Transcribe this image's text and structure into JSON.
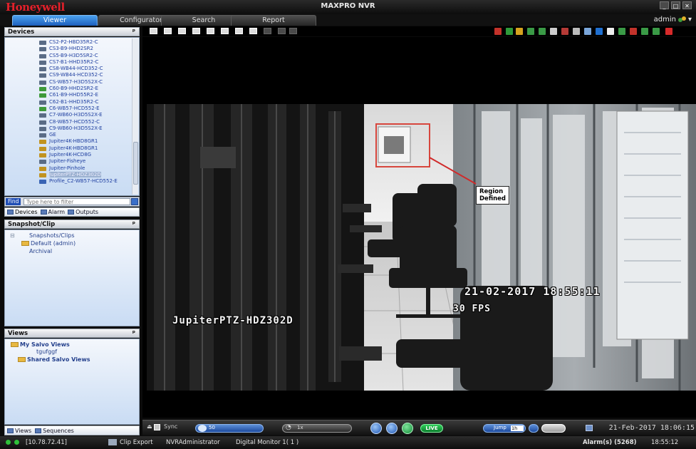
{
  "app": {
    "brand": "Honeywell",
    "title": "MAXPRO NVR",
    "user": "admin"
  },
  "tabs": [
    {
      "label": "Viewer",
      "active": true
    },
    {
      "label": "Configurator",
      "active": false
    },
    {
      "label": "Search",
      "active": false
    },
    {
      "label": "Report",
      "active": false
    }
  ],
  "devices_panel": {
    "title": "Devices",
    "items": [
      {
        "label": "CS2-P2-HBD35R2-C",
        "icon": "camera-icon"
      },
      {
        "label": "CS3-B9-HHD2SR2",
        "icon": "camera-icon"
      },
      {
        "label": "CS5-B9-H3D5SR2-C",
        "icon": "camera-icon"
      },
      {
        "label": "CS7-B1-HHD35R2-C",
        "icon": "camera-icon"
      },
      {
        "label": "CS8-WB44-HCD352-C",
        "icon": "camera-icon"
      },
      {
        "label": "CS9-WB44-HCD352-C",
        "icon": "camera-icon"
      },
      {
        "label": "CS-WB57-H3D5S2X-C",
        "icon": "camera-icon"
      },
      {
        "label": "C60-B9-HHD2SR2-E",
        "icon": "camera-green-icon"
      },
      {
        "label": "C61-B9-HHD55R2-E",
        "icon": "camera-green-icon"
      },
      {
        "label": "C62-B1-HHD35R2-C",
        "icon": "camera-icon"
      },
      {
        "label": "C6-WB57-HCD552-E",
        "icon": "camera-green-icon"
      },
      {
        "label": "C7-WB60-H3D5S2X-E",
        "icon": "camera-icon"
      },
      {
        "label": "C8-WB57-HCD552-C",
        "icon": "camera-icon"
      },
      {
        "label": "C9-WB60-H3D5S2X-E",
        "icon": "camera-icon"
      },
      {
        "label": "GE",
        "icon": "camera-icon"
      },
      {
        "label": "Jupiter4K-HBD8GR1",
        "icon": "camera-jupiter-icon"
      },
      {
        "label": "Jupiter4K-HBD8GR1",
        "icon": "camera-jupiter-icon"
      },
      {
        "label": "Jupiter4K-HCD8G",
        "icon": "camera-jupiter-icon"
      },
      {
        "label": "Jupiter-Fisheye",
        "icon": "camera-icon"
      },
      {
        "label": "Jupiter-Pinhole",
        "icon": "camera-jupiter-icon"
      },
      {
        "label": "JupiterPTZ-HDZ302D",
        "icon": "camera-jupiter-icon",
        "selected": true
      },
      {
        "label": "Profile_C2-WB57-HCD552-E",
        "icon": "camera-profile-icon"
      }
    ],
    "find_label": "Find",
    "find_placeholder": "Type here to filter",
    "tabs": [
      "Devices",
      "Alarm",
      "Outputs"
    ]
  },
  "snapshot_panel": {
    "title": "Snapshot/Clip",
    "root": "Snapshots/Clips",
    "child": "Default (admin)",
    "archival": "Archival"
  },
  "views_panel": {
    "title": "Views",
    "my_views": "My Salvo Views",
    "my_child": "tgufggf",
    "shared_views": "Shared Salvo Views",
    "tabs": [
      "Views",
      "Sequences"
    ]
  },
  "video": {
    "camera_name": "JupiterPTZ-HDZ302D",
    "timestamp": "21-02-2017 18:55:11",
    "fps": "30 FPS",
    "callout_line1": "Region",
    "callout_line2": "Defined"
  },
  "playback": {
    "sync_label": "Sync",
    "speed_label": "50",
    "speed2_label": "1x",
    "live_label": "LIVE",
    "jump_label": "Jump",
    "jump_value": "1h",
    "datetime": "21-Feb-2017 18:06:15"
  },
  "statusbar": {
    "ip": "[10.78.72.41]",
    "clip_export": "Clip Export",
    "user": "NVRAdministrator",
    "monitor": "Digital Monitor 1( 1 )",
    "alarms": "Alarm(s) (5268)",
    "time": "18:55:12"
  },
  "colors": {
    "accent": "#2f7ad9",
    "brand": "#e3202a",
    "live": "#1fae45"
  }
}
